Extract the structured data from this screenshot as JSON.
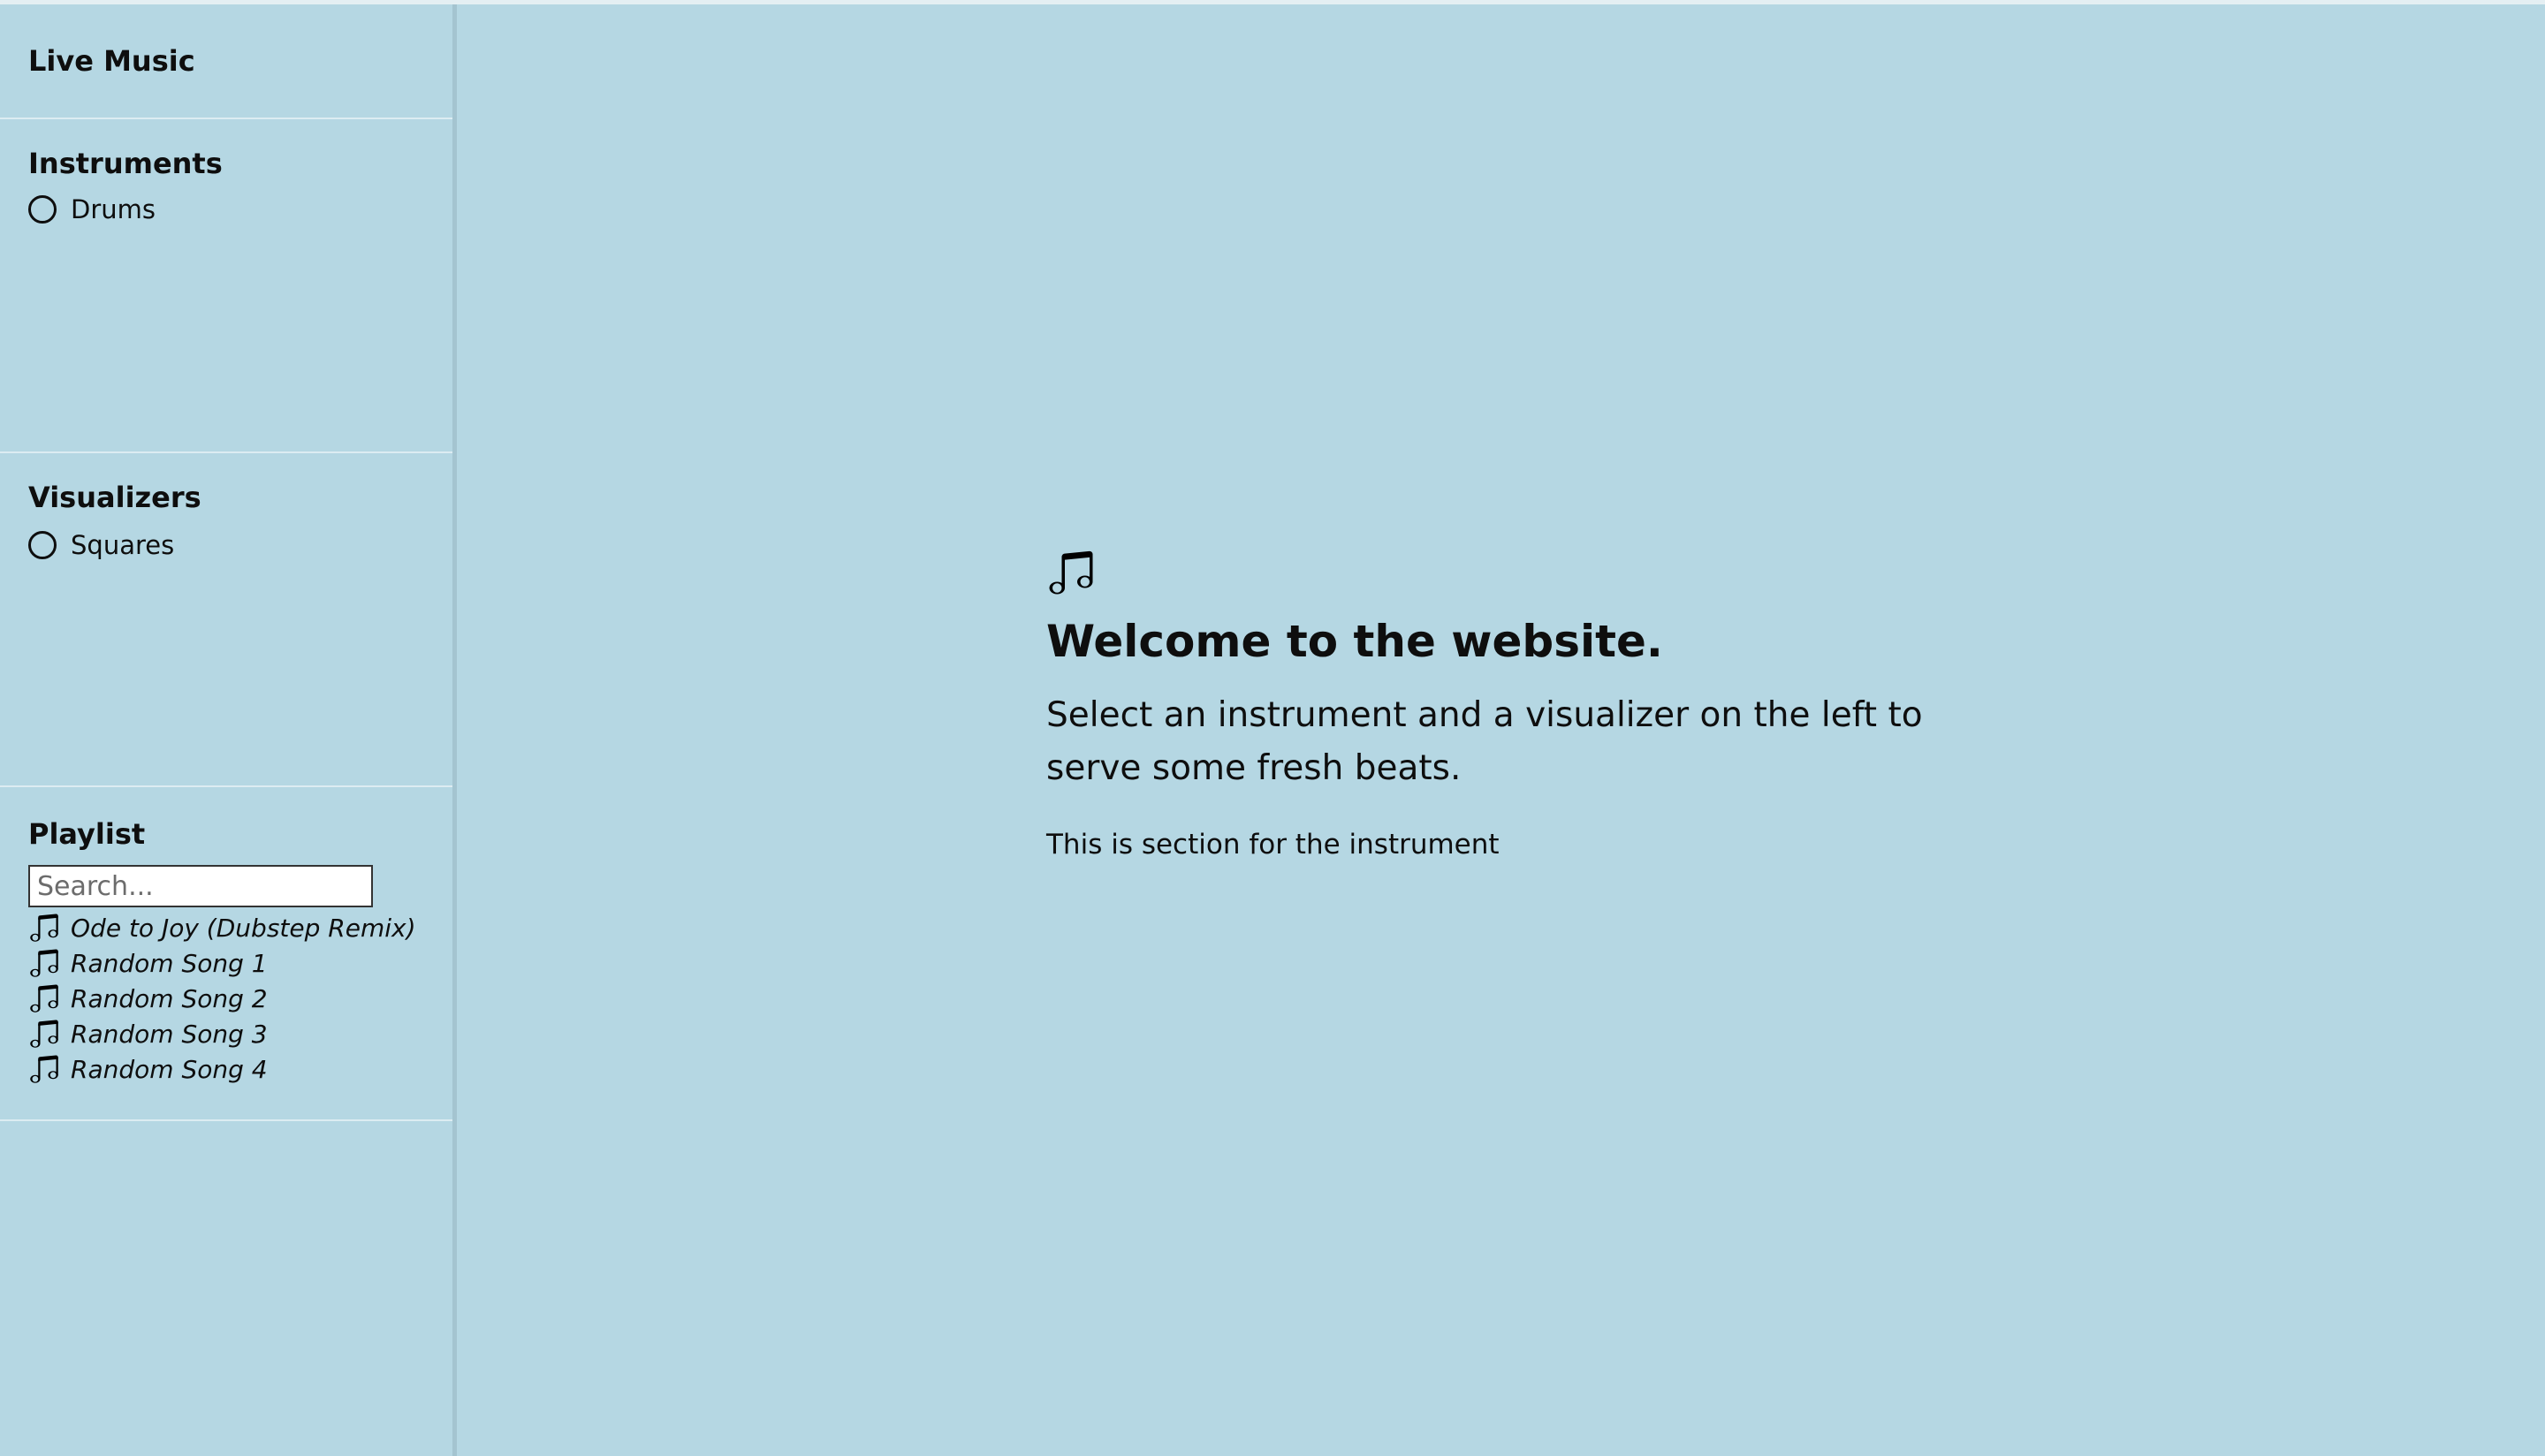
{
  "sidebar": {
    "title": "Live Music",
    "instruments": {
      "heading": "Instruments",
      "items": [
        {
          "label": "Drums"
        }
      ]
    },
    "visualizers": {
      "heading": "Visualizers",
      "items": [
        {
          "label": "Squares"
        }
      ]
    },
    "playlist": {
      "heading": "Playlist",
      "search_placeholder": "Search...",
      "songs": [
        {
          "label": "Ode to Joy (Dubstep Remix)"
        },
        {
          "label": "Random Song 1"
        },
        {
          "label": "Random Song 2"
        },
        {
          "label": "Random Song 3"
        },
        {
          "label": "Random Song 4"
        }
      ],
      "song_icon": "music-note-icon"
    }
  },
  "main": {
    "icon": "music-note-icon",
    "title": "Welcome to the website.",
    "text": "Select an instrument and a visualizer on the left to serve some fresh beats.",
    "subtext": "This is section for the instrument"
  },
  "colors": {
    "background": "#b5d7e3",
    "text": "#0e0e0e",
    "divider": "#dcecf2"
  }
}
